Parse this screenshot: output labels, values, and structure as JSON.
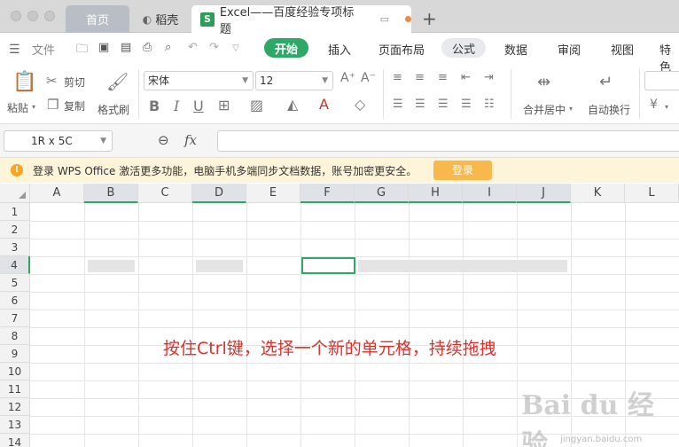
{
  "tabs": {
    "home": "首页",
    "daoke": "稻壳",
    "excel": "Excel——百度经验专项标题",
    "add": "+"
  },
  "menu": {
    "file": "文件",
    "items": [
      "开始",
      "插入",
      "页面布局",
      "公式",
      "数据",
      "审阅",
      "视图",
      "特色"
    ]
  },
  "ribbon": {
    "paste": "粘贴",
    "cut": "剪切",
    "copy": "复制",
    "format_painter": "格式刷",
    "font_name": "宋体",
    "font_size": "12",
    "merge_center": "合并居中",
    "wrap_text": "自动换行",
    "currency": "¥"
  },
  "formula_bar": {
    "name_box": "1R x 5C",
    "fx": "fx"
  },
  "notice": {
    "message": "登录 WPS Office 激活更多功能，电脑手机多端同步文档数据，账号加密更安全。",
    "login_button": "登录"
  },
  "grid": {
    "columns": [
      "A",
      "B",
      "C",
      "D",
      "E",
      "F",
      "G",
      "H",
      "I",
      "J",
      "K",
      "L"
    ],
    "selected_columns": [
      "B",
      "D",
      "F",
      "G",
      "H",
      "I",
      "J"
    ],
    "rows": [
      "1",
      "2",
      "3",
      "4",
      "5",
      "6",
      "7",
      "8",
      "9",
      "10",
      "11",
      "12",
      "13",
      "14"
    ],
    "selected_row": "4"
  },
  "caption": "按住Ctrl键，选择一个新的单元格，持续拖拽",
  "watermark": {
    "logo": "Bai du 经验",
    "url": "jingyan.baidu.com"
  },
  "colors": {
    "accent": "#2ea866",
    "caption": "#e0302a",
    "login": "#f8b84c"
  }
}
